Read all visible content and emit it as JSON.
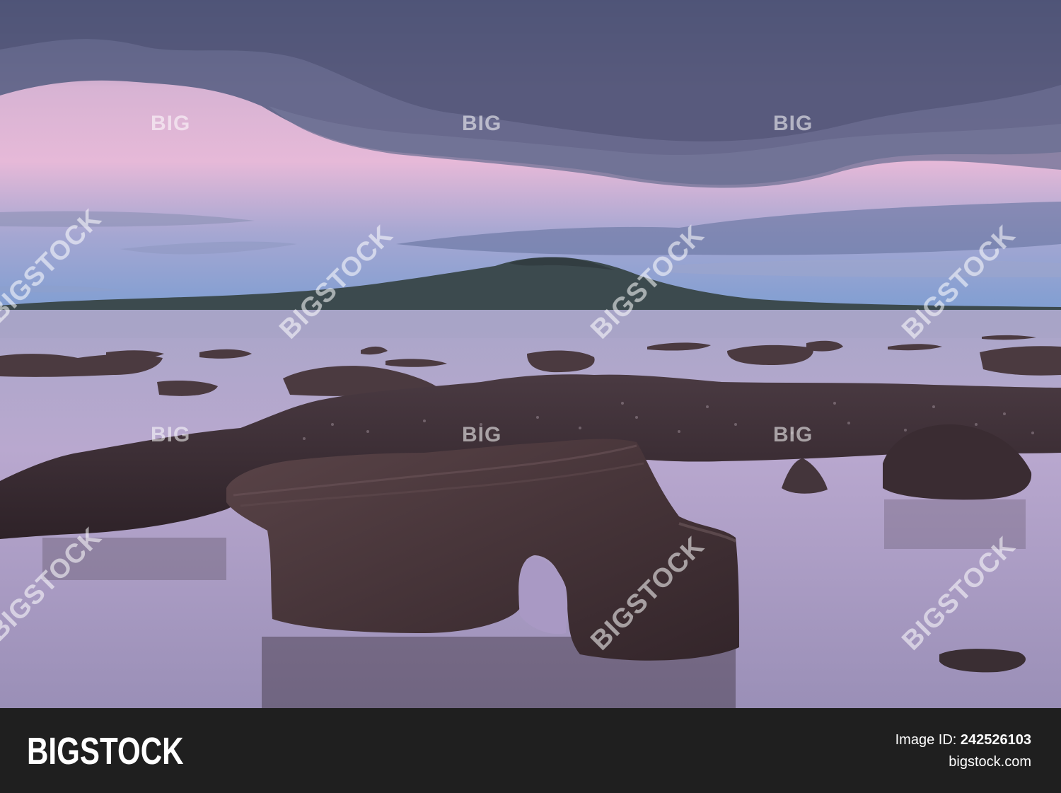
{
  "photo": {
    "subject": "volcanic island across calm sea at dusk with lava rock arch in foreground"
  },
  "watermarks": {
    "small_label": "BIG",
    "diagonal_label": "BIGSTOCK"
  },
  "footer": {
    "brand": "BIGSTOCK",
    "image_id_label": "Image ID:",
    "image_id_value": "242526103",
    "site": "bigstock.com"
  },
  "colors": {
    "footer_bg": "#1f1f1f",
    "sky_pink": "#e7b7d6",
    "cloud_slate": "#5e6486",
    "water_lilac": "#b7a8cc",
    "rock_dark": "#3a2b30"
  }
}
